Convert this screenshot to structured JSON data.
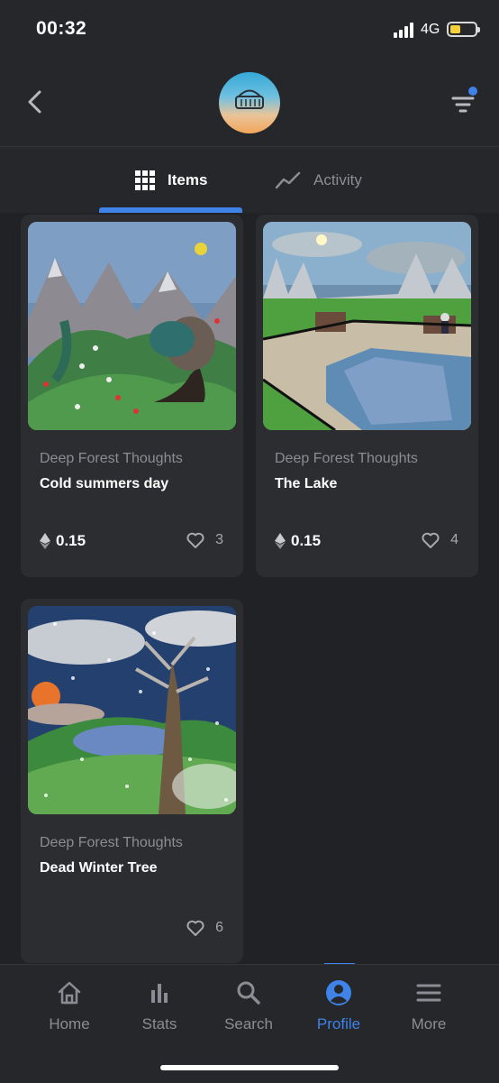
{
  "status": {
    "time": "00:32",
    "network": "4G"
  },
  "tabs": {
    "items_label": "Items",
    "activity_label": "Activity"
  },
  "cards": [
    {
      "collection": "Deep Forest Thoughts",
      "title": "Cold summers day",
      "price": "0.15",
      "likes": "3"
    },
    {
      "collection": "Deep Forest Thoughts",
      "title": "The Lake",
      "price": "0.15",
      "likes": "4"
    },
    {
      "collection": "Deep Forest Thoughts",
      "title": "Dead Winter Tree",
      "likes": "6"
    }
  ],
  "nav": {
    "items": [
      {
        "label": "Home",
        "icon": "home-icon"
      },
      {
        "label": "Stats",
        "icon": "stats-icon"
      },
      {
        "label": "Search",
        "icon": "search-icon"
      },
      {
        "label": "Profile",
        "icon": "profile-icon"
      },
      {
        "label": "More",
        "icon": "menu-icon"
      }
    ],
    "active": "Profile"
  },
  "colors": {
    "accent": "#3f82e8",
    "background": "#202225",
    "card": "#2b2d31",
    "muted": "#8a8d93"
  }
}
